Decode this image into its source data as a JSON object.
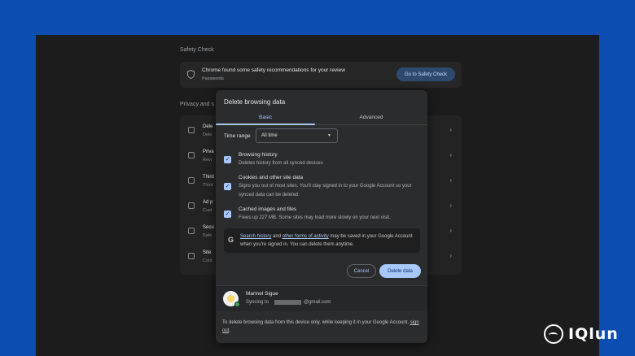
{
  "background": {
    "safety_check": {
      "title": "Safety Check",
      "card_title": "Chrome found some safety recommendations for your review",
      "card_sub": "Passwords",
      "button": "Go to Safety Check"
    },
    "privacy": {
      "title": "Privacy and s",
      "rows": [
        {
          "label": "Dele",
          "sub": "Dele"
        },
        {
          "label": "Priva",
          "sub": "Revi"
        },
        {
          "label": "Third",
          "sub": "Third"
        },
        {
          "label": "Ad p",
          "sub": "Cust"
        },
        {
          "label": "Secu",
          "sub": "Safe"
        },
        {
          "label": "Site",
          "sub": "Cont"
        }
      ]
    }
  },
  "dialog": {
    "title": "Delete browsing data",
    "tabs": {
      "basic": "Basic",
      "advanced": "Advanced"
    },
    "time_range": {
      "label": "Time range",
      "value": "All time"
    },
    "options": [
      {
        "title": "Browsing history",
        "desc": "Deletes history from all synced devices",
        "checked": true
      },
      {
        "title": "Cookies and other site data",
        "desc": "Signs you out of most sites. You'll stay signed in to your Google Account so your synced data can be deleted.",
        "checked": true
      },
      {
        "title": "Cached images and files",
        "desc": "Frees up 227 MB. Some sites may load more slowly on your next visit.",
        "checked": true
      }
    ],
    "notice": {
      "link1": "Search history",
      "text1": " and ",
      "link2": "other forms of activity",
      "text2": " may be saved in your Google Account when you're signed in. You can delete them anytime."
    },
    "cancel": "Cancel",
    "delete": "Delete data",
    "account": {
      "name": "Marinel Sigue",
      "sync_prefix": "Syncing to",
      "email_suffix": "@gmail.com"
    },
    "footer": {
      "text": "To delete browsing data from this device only, while keeping it in your Google Account, ",
      "link": "sign out",
      "end": "."
    }
  },
  "watermark": {
    "text": "IQlun"
  },
  "colors": {
    "accent": "#a8c7fa",
    "frame": "#0b4db0",
    "dialog_bg": "#2b2c2e"
  }
}
